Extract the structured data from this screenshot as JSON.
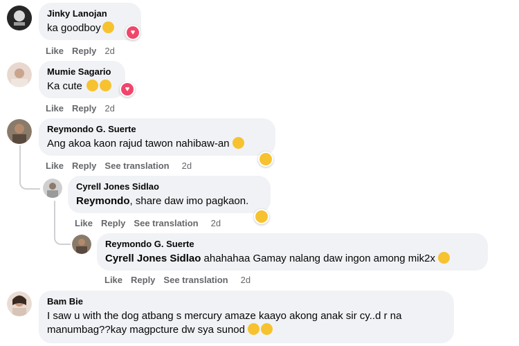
{
  "colors": {
    "bubble": "#f0f2f5",
    "meta": "#65676b",
    "text": "#050505",
    "heart": "#f0466b",
    "emoji": "#f7c22f"
  },
  "comments": [
    {
      "author": "Jinky Lanojan",
      "text": "ka goodboy",
      "emoji_icons": [
        "smiling-face-icon"
      ],
      "reaction_icon": "heart-react-icon",
      "actions": {
        "like": "Like",
        "reply": "Reply",
        "time": "2d"
      }
    },
    {
      "author": "Mumie Sagario",
      "text": "Ka cute",
      "emoji_icons": [
        "heart-eyes-face-icon",
        "heart-eyes-face-icon"
      ],
      "reaction_icon": "heart-react-icon",
      "actions": {
        "like": "Like",
        "reply": "Reply",
        "time": "2d"
      }
    },
    {
      "author": "Reymondo G. Suerte",
      "text": "Ang akoa kaon rajud tawon nahibaw-an",
      "emoji_icons": [
        "laughing-face-icon"
      ],
      "reaction_icon": "haha-react-icon",
      "actions": {
        "like": "Like",
        "reply": "Reply",
        "translate": "See translation",
        "time": "2d"
      }
    },
    {
      "author": "Cyrell Jones Sidlao",
      "mention": "Reymondo",
      "text": ", share daw imo pagkaon.",
      "reaction_icon": "haha-react-icon",
      "actions": {
        "like": "Like",
        "reply": "Reply",
        "translate": "See translation",
        "time": "2d"
      }
    },
    {
      "author": "Reymondo G. Suerte",
      "mention": "Cyrell Jones Sidlao",
      "text": " ahahahaa Gamay nalang daw ingon among mik2x",
      "emoji_icons": [
        "laughing-face-icon"
      ],
      "actions": {
        "like": "Like",
        "reply": "Reply",
        "translate": "See translation",
        "time": "2d"
      }
    },
    {
      "author": "Bam Bie",
      "text_line1": "I saw u with the dog atbang s mercury amaze kaayo akong anak sir cy..d r na",
      "text_line2": "manumbag??kay magpcture dw sya sunod",
      "emoji_icons": [
        "rofl-face-icon",
        "grinning-face-icon"
      ]
    }
  ]
}
